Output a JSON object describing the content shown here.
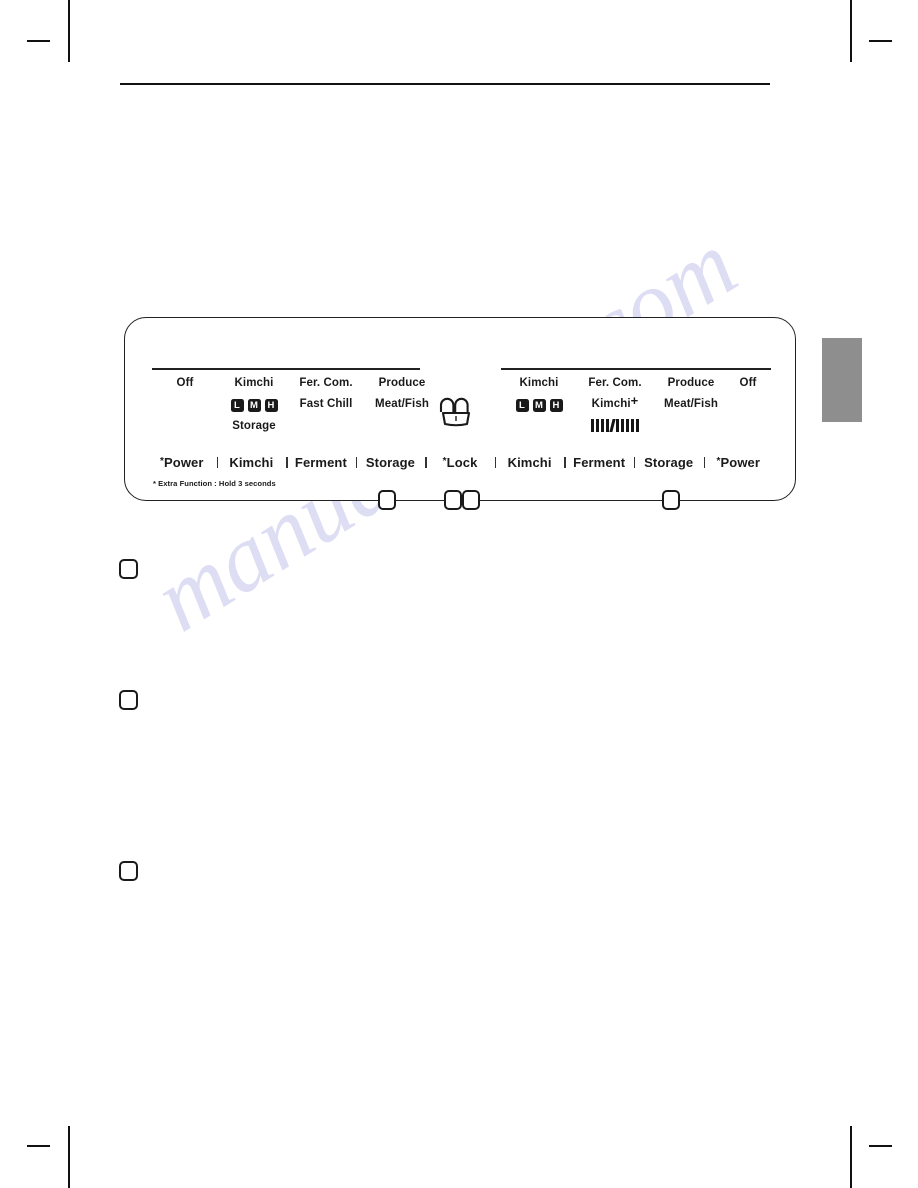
{
  "page": {
    "watermark": "manualshive.com"
  },
  "panel": {
    "left_display": {
      "row1": [
        "Off",
        "Kimchi",
        "Fer. Com.",
        "Produce"
      ],
      "row2_kimchi_chips": [
        "L",
        "M",
        "H"
      ],
      "row2_fer_com": "Fast Chill",
      "row2_produce": "Meat/Fish",
      "row3_kimchi": "Storage"
    },
    "right_display": {
      "row1": [
        "Kimchi",
        "Fer. Com.",
        "Produce",
        "Off"
      ],
      "row2_kimchi_chips": [
        "L",
        "M",
        "H"
      ],
      "row2_fer_com": "Kimchi",
      "row2_fer_com_sup": "+",
      "row2_produce": "Meat/Fish",
      "row3_bar_count": 10
    },
    "lock_icon": "padlock-icon",
    "left_buttons": [
      {
        "star": "*",
        "label": "Power"
      },
      {
        "star": "",
        "label": "Kimchi"
      },
      {
        "star": "",
        "label": "Ferment"
      },
      {
        "star": "",
        "label": "Storage"
      }
    ],
    "right_buttons": [
      {
        "star": "*",
        "label": "Lock"
      },
      {
        "star": "",
        "label": "Kimchi"
      },
      {
        "star": "",
        "label": "Ferment"
      },
      {
        "star": "",
        "label": "Storage"
      },
      {
        "star": "*",
        "label": "Power"
      }
    ],
    "footnote": "* Extra Function : Hold 3 seconds",
    "callout_boxes": [
      "",
      "",
      "",
      ""
    ]
  },
  "steps": [
    {
      "marker": ""
    },
    {
      "marker": ""
    },
    {
      "marker": ""
    }
  ],
  "colors": {
    "ink": "#1a1a1a",
    "side_tab": "#8e8e8e",
    "watermark": "#c9c9ee"
  }
}
